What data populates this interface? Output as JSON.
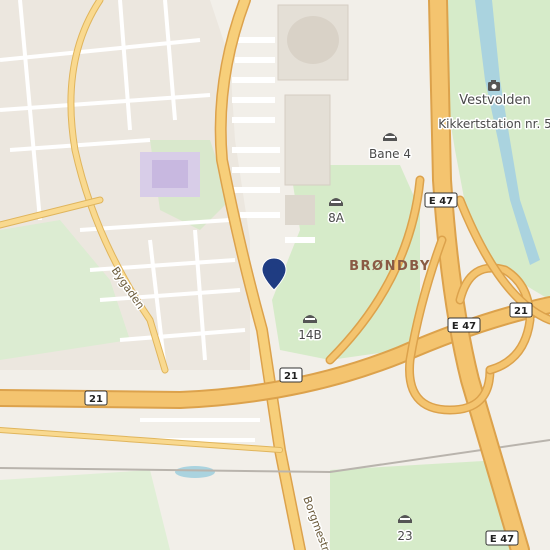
{
  "map": {
    "places": {
      "vestvolden": "Vestvolden",
      "kikkert": "Kikkertstation nr. 5",
      "bane4": "Bane 4",
      "pitch_8a": "8A",
      "pitch_14b": "14B",
      "pitch_23": "23",
      "brondby": "BRØNDBY"
    },
    "streets": {
      "bygaden": "Bygaden",
      "borgmester": "Borgmestr"
    },
    "shields": {
      "e47_top": "E 47",
      "e47_mid": "E 47",
      "e47_right": "21",
      "road21_left": "21",
      "road21_center": "21",
      "e47_bottom": "E 47"
    },
    "icons": {
      "pitch": "stadium-icon",
      "camera": "camera-icon",
      "marker": "location-pin-icon"
    },
    "colors": {
      "background": "#f2efe9",
      "park": "#d6ebc9",
      "motorway": "#f4c46f",
      "motorway_casing": "#dca24c",
      "marker": "#1f3c82"
    }
  }
}
